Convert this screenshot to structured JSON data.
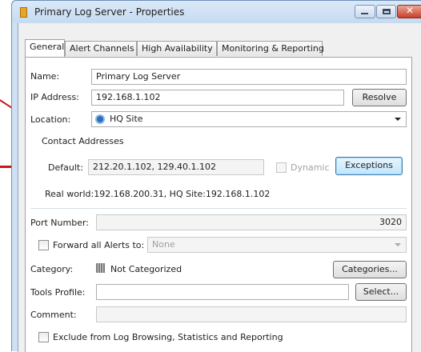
{
  "window": {
    "title": "Primary Log Server - Properties",
    "buttons": {
      "minimize": "minimize",
      "maximize": "maximize",
      "close": "close"
    }
  },
  "tabs": [
    {
      "label": "General",
      "active": true
    },
    {
      "label": "Alert Channels",
      "active": false
    },
    {
      "label": "High Availability",
      "active": false
    },
    {
      "label": "Monitoring & Reporting",
      "active": false
    }
  ],
  "general": {
    "name_label": "Name:",
    "name_value": "Primary Log Server",
    "ip_label": "IP Address:",
    "ip_value": "192.168.1.102",
    "resolve_button": "Resolve",
    "location_label": "Location:",
    "location_value": "HQ Site",
    "location_icon": "site-icon",
    "contact_addresses_label": "Contact Addresses",
    "default_label": "Default:",
    "default_value": "212.20.1.102, 129.40.1.102",
    "dynamic_label": "Dynamic",
    "exceptions_button": "Exceptions",
    "contact_summary": "Real world:192.168.200.31, HQ Site:192.168.1.102",
    "port_label": "Port Number:",
    "port_value": "3020",
    "forward_label": "Forward all Alerts to:",
    "forward_value": "None",
    "category_label": "Category:",
    "category_value": "Not Categorized",
    "categories_button": "Categories...",
    "tools_profile_label": "Tools Profile:",
    "tools_profile_value": "",
    "select_button": "Select...",
    "comment_label": "Comment:",
    "comment_value": "",
    "exclude_label": "Exclude from Log Browsing, Statistics and Reporting"
  },
  "colors": {
    "callout": "#c8161d",
    "title_bar": "#cfe0f2",
    "location_icon": "#2f6fb8"
  }
}
